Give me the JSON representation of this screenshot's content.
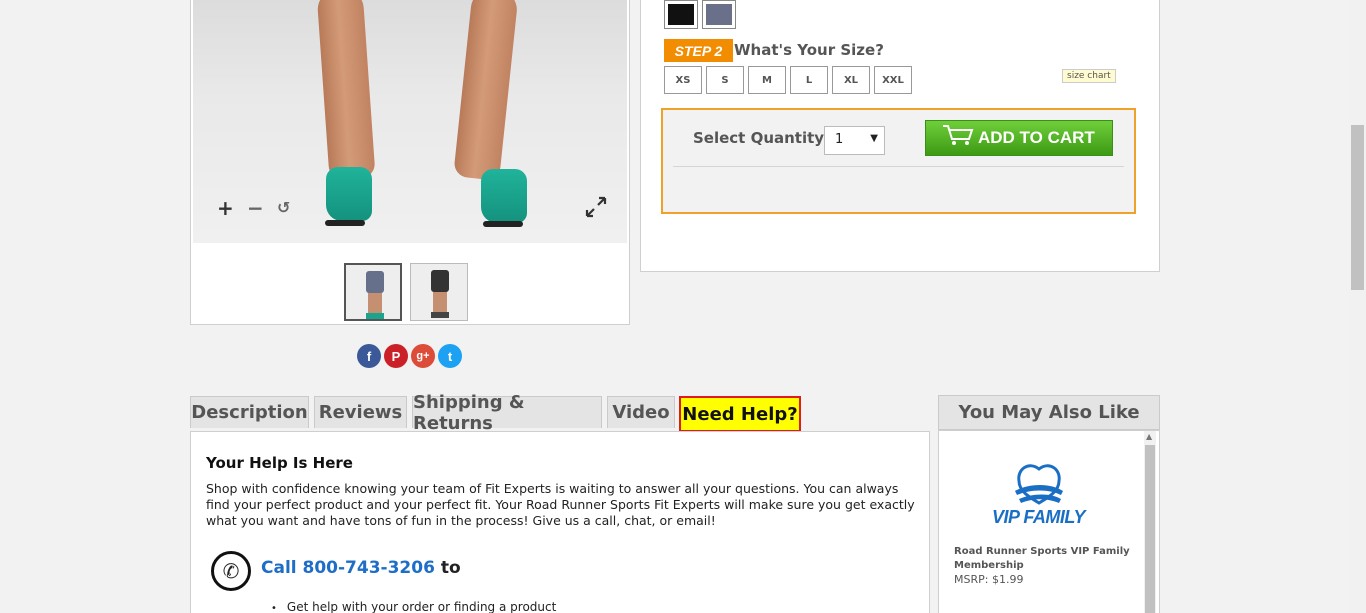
{
  "product_image": {
    "zoom_in": "+",
    "zoom_out": "−",
    "reset": "↺"
  },
  "social": {
    "facebook": "f",
    "pinterest": "P",
    "google_plus": "g+",
    "twitter": "t",
    "colors": {
      "facebook": "#3b5998",
      "pinterest": "#cb2027",
      "google_plus": "#dd4b39",
      "twitter": "#1da1f2"
    }
  },
  "options": {
    "swatches": [
      {
        "name": "black",
        "color": "#111111"
      },
      {
        "name": "slate",
        "color": "#6a708a"
      }
    ],
    "step_badge": "STEP 2",
    "step_title": "What's Your Size?",
    "sizes": [
      "XS",
      "S",
      "M",
      "L",
      "XL",
      "XXL"
    ],
    "size_chart_label": "size chart",
    "quantity_label": "Select Quantity:",
    "quantity_value": "1",
    "add_to_cart_label": "ADD TO CART",
    "accent_color": "#f28c00"
  },
  "tabs": {
    "description": "Description",
    "reviews": "Reviews",
    "shipping": "Shipping & Returns",
    "video": "Video",
    "need_help": "Need Help?"
  },
  "help": {
    "title": "Your Help Is Here",
    "body": "Shop with confidence knowing your team of Fit Experts is waiting to answer all your questions. You can always find your perfect product and your perfect fit. Your Road Runner Sports Fit Experts will make sure you get exactly what you want and have tons of fun in the process! Give us a call, chat, or email!",
    "call_link": "Call 800-743-3206",
    "call_suffix": " to",
    "bullet_1": "Get help with your order or finding a product"
  },
  "ymal": {
    "header": "You May Also Like",
    "logo_text": "VIP FAMILY",
    "product_name": "Road Runner Sports VIP Family Membership",
    "price": "MSRP:  $1.99"
  }
}
